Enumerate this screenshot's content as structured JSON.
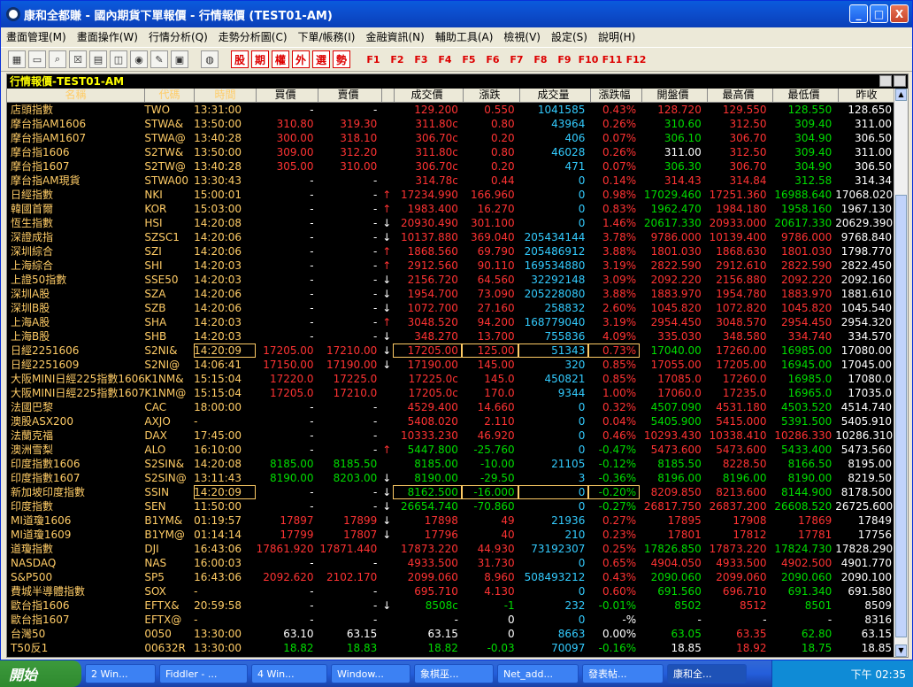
{
  "window": {
    "title": "康和全都賺 - 國內期貨下單報價 - 行情報價 (TEST01-AM)",
    "controls": [
      "_",
      "□",
      "X"
    ]
  },
  "menu": [
    "畫面管理(M)",
    "畫面操作(W)",
    "行情分析(Q)",
    "走勢分析圖(C)",
    "下單/帳務(I)",
    "金融資訊(N)",
    "輔助工具(A)",
    "檢視(V)",
    "設定(S)",
    "說明(H)"
  ],
  "toolbar": {
    "red_buttons": [
      "股",
      "期",
      "權",
      "外",
      "選",
      "勢"
    ],
    "fkeys": [
      "F1",
      "F2",
      "F3",
      "F4",
      "F5",
      "F6",
      "F7",
      "F8",
      "F9",
      "F10",
      "F11",
      "F12"
    ]
  },
  "panel": {
    "title": "行情報價-TEST01-AM"
  },
  "columns": [
    "名稱",
    "代碼",
    "時間",
    "買價",
    "賣價",
    "",
    "成交價",
    "漲跌",
    "成交量",
    "漲跌幅",
    "開盤價",
    "最高價",
    "最低價",
    "昨收"
  ],
  "colors": {
    "up": "#ff3333",
    "down": "#00dd00",
    "neutral": "#ffffff",
    "vol": "#33ccff",
    "name": "#ffcc66"
  },
  "rows": [
    {
      "n": "店頭指數",
      "c": "TWO",
      "t": "13:31:00",
      "b": "-",
      "s": "-",
      "a": "",
      "p": "129.200",
      "ch": "0.550",
      "v": "1041585",
      "pct": "0.43%",
      "o": "128.720",
      "h": "129.550",
      "l": "128.550",
      "y": "128.650",
      "k": "u"
    },
    {
      "n": "摩台指AM1606",
      "c": "STWA&",
      "t": "13:50:00",
      "b": "310.80",
      "s": "319.30",
      "a": "",
      "p": "311.80c",
      "ch": "0.80",
      "v": "43964",
      "pct": "0.26%",
      "o": "310.60",
      "h": "312.50",
      "l": "309.40",
      "y": "311.00",
      "k": "u"
    },
    {
      "n": "摩台指AM1607",
      "c": "STWA@",
      "t": "13:40:28",
      "b": "300.00",
      "s": "318.10",
      "a": "",
      "p": "306.70c",
      "ch": "0.20",
      "v": "406",
      "pct": "0.07%",
      "o": "306.10",
      "h": "306.70",
      "l": "304.90",
      "y": "306.50",
      "k": "u"
    },
    {
      "n": "摩台指1606",
      "c": "S2TW&",
      "t": "13:50:00",
      "b": "309.00",
      "s": "312.20",
      "a": "",
      "p": "311.80c",
      "ch": "0.80",
      "v": "46028",
      "pct": "0.26%",
      "o": "311.00",
      "h": "312.50",
      "l": "309.40",
      "y": "311.00",
      "k": "u"
    },
    {
      "n": "摩台指1607",
      "c": "S2TW@",
      "t": "13:40:28",
      "b": "305.00",
      "s": "310.00",
      "a": "",
      "p": "306.70c",
      "ch": "0.20",
      "v": "471",
      "pct": "0.07%",
      "o": "306.30",
      "h": "306.70",
      "l": "304.90",
      "y": "306.50",
      "k": "u"
    },
    {
      "n": "摩台指AM現貨",
      "c": "STWA00",
      "t": "13:30:43",
      "b": "-",
      "s": "-",
      "a": "",
      "p": "314.78c",
      "ch": "0.44",
      "v": "0",
      "pct": "0.14%",
      "o": "314.43",
      "h": "314.84",
      "l": "312.58",
      "y": "314.34",
      "k": "u"
    },
    {
      "n": "日經指數",
      "c": "NKI",
      "t": "15:00:01",
      "b": "-",
      "s": "-",
      "a": "↑",
      "p": "17234.990",
      "ch": "166.960",
      "v": "0",
      "pct": "0.98%",
      "o": "17029.460",
      "h": "17251.360",
      "l": "16988.640",
      "y": "17068.020",
      "k": "u"
    },
    {
      "n": "韓國首爾",
      "c": "KOR",
      "t": "15:03:00",
      "b": "-",
      "s": "-",
      "a": "↑",
      "p": "1983.400",
      "ch": "16.270",
      "v": "0",
      "pct": "0.83%",
      "o": "1962.470",
      "h": "1984.180",
      "l": "1958.160",
      "y": "1967.130",
      "k": "u"
    },
    {
      "n": "恆生指數",
      "c": "HSI",
      "t": "14:20:08",
      "b": "-",
      "s": "-",
      "a": "↓",
      "p": "20930.490",
      "ch": "301.100",
      "v": "0",
      "pct": "1.46%",
      "o": "20617.330",
      "h": "20933.000",
      "l": "20617.330",
      "y": "20629.390",
      "k": "u"
    },
    {
      "n": "深證成指",
      "c": "SZSC1",
      "t": "14:20:06",
      "b": "-",
      "s": "-",
      "a": "↓",
      "p": "10137.880",
      "ch": "369.040",
      "v": "205434144",
      "pct": "3.78%",
      "o": "9786.000",
      "h": "10139.400",
      "l": "9786.000",
      "y": "9768.840",
      "k": "u"
    },
    {
      "n": "深圳綜合",
      "c": "SZI",
      "t": "14:20:06",
      "b": "-",
      "s": "-",
      "a": "↑",
      "p": "1868.560",
      "ch": "69.790",
      "v": "205486912",
      "pct": "3.88%",
      "o": "1801.030",
      "h": "1868.630",
      "l": "1801.030",
      "y": "1798.770",
      "k": "u"
    },
    {
      "n": "上海綜合",
      "c": "SHI",
      "t": "14:20:03",
      "b": "-",
      "s": "-",
      "a": "↑",
      "p": "2912.560",
      "ch": "90.110",
      "v": "169534880",
      "pct": "3.19%",
      "o": "2822.590",
      "h": "2912.610",
      "l": "2822.590",
      "y": "2822.450",
      "k": "u"
    },
    {
      "n": "上證50指數",
      "c": "SSE50",
      "t": "14:20:03",
      "b": "-",
      "s": "-",
      "a": "↓",
      "p": "2156.720",
      "ch": "64.560",
      "v": "32292148",
      "pct": "3.09%",
      "o": "2092.220",
      "h": "2156.880",
      "l": "2092.220",
      "y": "2092.160",
      "k": "u"
    },
    {
      "n": "深圳A股",
      "c": "SZA",
      "t": "14:20:06",
      "b": "-",
      "s": "-",
      "a": "↓",
      "p": "1954.700",
      "ch": "73.090",
      "v": "205228080",
      "pct": "3.88%",
      "o": "1883.970",
      "h": "1954.780",
      "l": "1883.970",
      "y": "1881.610",
      "k": "u"
    },
    {
      "n": "深圳B股",
      "c": "SZB",
      "t": "14:20:06",
      "b": "-",
      "s": "-",
      "a": "↓",
      "p": "1072.700",
      "ch": "27.160",
      "v": "258832",
      "pct": "2.60%",
      "o": "1045.820",
      "h": "1072.820",
      "l": "1045.820",
      "y": "1045.540",
      "k": "u"
    },
    {
      "n": "上海A股",
      "c": "SHA",
      "t": "14:20:03",
      "b": "-",
      "s": "-",
      "a": "↑",
      "p": "3048.520",
      "ch": "94.200",
      "v": "168779040",
      "pct": "3.19%",
      "o": "2954.450",
      "h": "3048.570",
      "l": "2954.450",
      "y": "2954.320",
      "k": "u"
    },
    {
      "n": "上海B股",
      "c": "SHB",
      "t": "14:20:03",
      "b": "-",
      "s": "-",
      "a": "↓",
      "p": "348.270",
      "ch": "13.700",
      "v": "755836",
      "pct": "4.09%",
      "o": "335.030",
      "h": "348.580",
      "l": "334.740",
      "y": "334.570",
      "k": "u"
    },
    {
      "n": "日經2251606",
      "c": "S2NI&",
      "t": "14:20:09",
      "b": "17205.00",
      "s": "17210.00",
      "a": "↓",
      "p": "17205.00",
      "ch": "125.00",
      "v": "51343",
      "pct": "0.73%",
      "o": "17040.00",
      "h": "17260.00",
      "l": "16985.00",
      "y": "17080.00",
      "k": "u",
      "hl": true
    },
    {
      "n": "日經2251609",
      "c": "S2NI@",
      "t": "14:06:41",
      "b": "17150.00",
      "s": "17190.00",
      "a": "↓",
      "p": "17190.00",
      "ch": "145.00",
      "v": "320",
      "pct": "0.85%",
      "o": "17055.00",
      "h": "17205.00",
      "l": "16945.00",
      "y": "17045.00",
      "k": "u"
    },
    {
      "n": "大阪MINI日經225指數1606",
      "c": "K1NM&",
      "t": "15:15:04",
      "b": "17220.0",
      "s": "17225.0",
      "a": "",
      "p": "17225.0c",
      "ch": "145.0",
      "v": "450821",
      "pct": "0.85%",
      "o": "17085.0",
      "h": "17260.0",
      "l": "16985.0",
      "y": "17080.0",
      "k": "u"
    },
    {
      "n": "大阪MINI日經225指數1607",
      "c": "K1NM@",
      "t": "15:15:04",
      "b": "17205.0",
      "s": "17210.0",
      "a": "",
      "p": "17205.0c",
      "ch": "170.0",
      "v": "9344",
      "pct": "1.00%",
      "o": "17060.0",
      "h": "17235.0",
      "l": "16965.0",
      "y": "17035.0",
      "k": "u"
    },
    {
      "n": "法國巴黎",
      "c": "CAC",
      "t": "18:00:00",
      "b": "-",
      "s": "-",
      "a": "",
      "p": "4529.400",
      "ch": "14.660",
      "v": "0",
      "pct": "0.32%",
      "o": "4507.090",
      "h": "4531.180",
      "l": "4503.520",
      "y": "4514.740",
      "k": "u"
    },
    {
      "n": "澳股ASX200",
      "c": "AXJO",
      "t": "-",
      "b": "-",
      "s": "-",
      "a": "",
      "p": "5408.020",
      "ch": "2.110",
      "v": "0",
      "pct": "0.04%",
      "o": "5405.900",
      "h": "5415.000",
      "l": "5391.500",
      "y": "5405.910",
      "k": "u"
    },
    {
      "n": "法蘭克福",
      "c": "DAX",
      "t": "17:45:00",
      "b": "-",
      "s": "-",
      "a": "",
      "p": "10333.230",
      "ch": "46.920",
      "v": "0",
      "pct": "0.46%",
      "o": "10293.430",
      "h": "10338.410",
      "l": "10286.330",
      "y": "10286.310",
      "k": "u"
    },
    {
      "n": "澳洲雪梨",
      "c": "ALO",
      "t": "16:10:00",
      "b": "-",
      "s": "-",
      "a": "↑",
      "p": "5447.800",
      "ch": "-25.760",
      "v": "0",
      "pct": "-0.47%",
      "o": "5473.600",
      "h": "5473.600",
      "l": "5433.400",
      "y": "5473.560",
      "k": "d"
    },
    {
      "n": "印度指數1606",
      "c": "S2SIN&",
      "t": "14:20:08",
      "b": "8185.00",
      "s": "8185.50",
      "a": "",
      "p": "8185.00",
      "ch": "-10.00",
      "v": "21105",
      "pct": "-0.12%",
      "o": "8185.50",
      "h": "8228.50",
      "l": "8166.50",
      "y": "8195.00",
      "k": "d"
    },
    {
      "n": "印度指數1607",
      "c": "S2SIN@",
      "t": "13:11:43",
      "b": "8190.00",
      "s": "8203.00",
      "a": "↓",
      "p": "8190.00",
      "ch": "-29.50",
      "v": "3",
      "pct": "-0.36%",
      "o": "8196.00",
      "h": "8196.00",
      "l": "8190.00",
      "y": "8219.50",
      "k": "d"
    },
    {
      "n": "新加坡印度指數",
      "c": "SSIN",
      "t": "14:20:09",
      "b": "-",
      "s": "-",
      "a": "↓",
      "p": "8162.500",
      "ch": "-16.000",
      "v": "0",
      "pct": "-0.20%",
      "o": "8209.850",
      "h": "8213.600",
      "l": "8144.900",
      "y": "8178.500",
      "k": "d",
      "hl": true
    },
    {
      "n": "印度指數",
      "c": "SEN",
      "t": "11:50:00",
      "b": "-",
      "s": "-",
      "a": "↓",
      "p": "26654.740",
      "ch": "-70.860",
      "v": "0",
      "pct": "-0.27%",
      "o": "26817.750",
      "h": "26837.200",
      "l": "26608.520",
      "y": "26725.600",
      "k": "d"
    },
    {
      "n": "MI道瓊1606",
      "c": "B1YM&",
      "t": "01:19:57",
      "b": "17897",
      "s": "17899",
      "a": "↓",
      "p": "17898",
      "ch": "49",
      "v": "21936",
      "pct": "0.27%",
      "o": "17895",
      "h": "17908",
      "l": "17869",
      "y": "17849",
      "k": "u"
    },
    {
      "n": "MI道瓊1609",
      "c": "B1YM@",
      "t": "01:14:14",
      "b": "17799",
      "s": "17807",
      "a": "↓",
      "p": "17796",
      "ch": "40",
      "v": "210",
      "pct": "0.23%",
      "o": "17801",
      "h": "17812",
      "l": "17781",
      "y": "17756",
      "k": "u"
    },
    {
      "n": "道瓊指數",
      "c": "DJI",
      "t": "16:43:06",
      "b": "17861.920",
      "s": "17871.440",
      "a": "",
      "p": "17873.220",
      "ch": "44.930",
      "v": "73192307",
      "pct": "0.25%",
      "o": "17826.850",
      "h": "17873.220",
      "l": "17824.730",
      "y": "17828.290",
      "k": "u"
    },
    {
      "n": "NASDAQ",
      "c": "NAS",
      "t": "16:00:03",
      "b": "-",
      "s": "-",
      "a": "",
      "p": "4933.500",
      "ch": "31.730",
      "v": "0",
      "pct": "0.65%",
      "o": "4904.050",
      "h": "4933.500",
      "l": "4902.500",
      "y": "4901.770",
      "k": "u"
    },
    {
      "n": "S&P500",
      "c": "SP5",
      "t": "16:43:06",
      "b": "2092.620",
      "s": "2102.170",
      "a": "",
      "p": "2099.060",
      "ch": "8.960",
      "v": "508493212",
      "pct": "0.43%",
      "o": "2090.060",
      "h": "2099.060",
      "l": "2090.060",
      "y": "2090.100",
      "k": "u"
    },
    {
      "n": "費城半導體指數",
      "c": "SOX",
      "t": "-",
      "b": "-",
      "s": "-",
      "a": "",
      "p": "695.710",
      "ch": "4.130",
      "v": "0",
      "pct": "0.60%",
      "o": "691.560",
      "h": "696.710",
      "l": "691.340",
      "y": "691.580",
      "k": "u"
    },
    {
      "n": "歐台指1606",
      "c": "EFTX&",
      "t": "20:59:58",
      "b": "-",
      "s": "-",
      "a": "↓",
      "p": "8508c",
      "ch": "-1",
      "v": "232",
      "pct": "-0.01%",
      "o": "8502",
      "h": "8512",
      "l": "8501",
      "y": "8509",
      "k": "d"
    },
    {
      "n": "歐台指1607",
      "c": "EFTX@",
      "t": "-",
      "b": "-",
      "s": "-",
      "a": "",
      "p": "-",
      "ch": "0",
      "v": "0",
      "pct": "-%",
      "o": "-",
      "h": "-",
      "l": "-",
      "y": "8316",
      "k": "n"
    },
    {
      "n": "台灣50",
      "c": "0050",
      "t": "13:30:00",
      "b": "63.10",
      "s": "63.15",
      "a": "",
      "p": "63.15",
      "ch": "0",
      "v": "8663",
      "pct": "0.00%",
      "o": "63.05",
      "h": "63.35",
      "l": "62.80",
      "y": "63.15",
      "k": "n"
    },
    {
      "n": "T50反1",
      "c": "00632R",
      "t": "13:30:00",
      "b": "18.82",
      "s": "18.83",
      "a": "",
      "p": "18.82",
      "ch": "-0.03",
      "v": "70097",
      "pct": "-0.16%",
      "o": "18.85",
      "h": "18.92",
      "l": "18.75",
      "y": "18.85",
      "k": "d"
    }
  ],
  "taskbar": {
    "start": "開始",
    "tasks": [
      "2 Win...",
      "Fiddler - ...",
      "4 Win...",
      "Window...",
      "象棋巫...",
      "Net_add...",
      "發表帖...",
      "康和全..."
    ],
    "clock": "下午 02:35"
  }
}
